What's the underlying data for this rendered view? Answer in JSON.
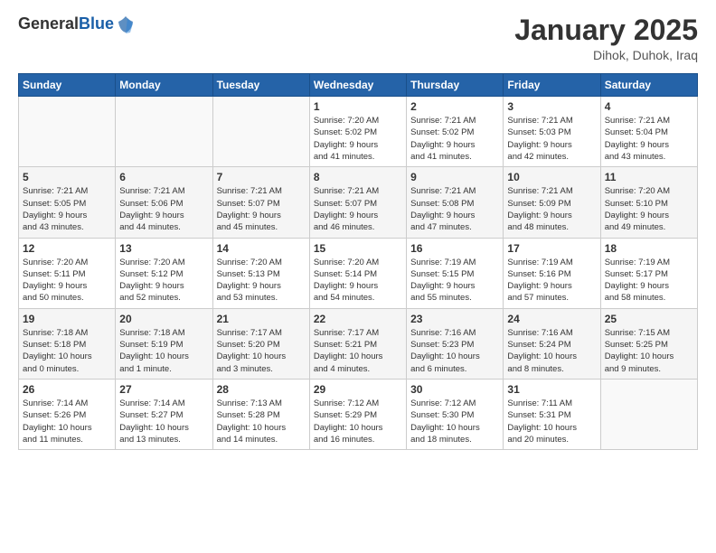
{
  "header": {
    "logo_general": "General",
    "logo_blue": "Blue",
    "month_title": "January 2025",
    "location": "Dihok, Duhok, Iraq"
  },
  "weekdays": [
    "Sunday",
    "Monday",
    "Tuesday",
    "Wednesday",
    "Thursday",
    "Friday",
    "Saturday"
  ],
  "weeks": [
    [
      {
        "day": "",
        "info": ""
      },
      {
        "day": "",
        "info": ""
      },
      {
        "day": "",
        "info": ""
      },
      {
        "day": "1",
        "info": "Sunrise: 7:20 AM\nSunset: 5:02 PM\nDaylight: 9 hours\nand 41 minutes."
      },
      {
        "day": "2",
        "info": "Sunrise: 7:21 AM\nSunset: 5:02 PM\nDaylight: 9 hours\nand 41 minutes."
      },
      {
        "day": "3",
        "info": "Sunrise: 7:21 AM\nSunset: 5:03 PM\nDaylight: 9 hours\nand 42 minutes."
      },
      {
        "day": "4",
        "info": "Sunrise: 7:21 AM\nSunset: 5:04 PM\nDaylight: 9 hours\nand 43 minutes."
      }
    ],
    [
      {
        "day": "5",
        "info": "Sunrise: 7:21 AM\nSunset: 5:05 PM\nDaylight: 9 hours\nand 43 minutes."
      },
      {
        "day": "6",
        "info": "Sunrise: 7:21 AM\nSunset: 5:06 PM\nDaylight: 9 hours\nand 44 minutes."
      },
      {
        "day": "7",
        "info": "Sunrise: 7:21 AM\nSunset: 5:07 PM\nDaylight: 9 hours\nand 45 minutes."
      },
      {
        "day": "8",
        "info": "Sunrise: 7:21 AM\nSunset: 5:07 PM\nDaylight: 9 hours\nand 46 minutes."
      },
      {
        "day": "9",
        "info": "Sunrise: 7:21 AM\nSunset: 5:08 PM\nDaylight: 9 hours\nand 47 minutes."
      },
      {
        "day": "10",
        "info": "Sunrise: 7:21 AM\nSunset: 5:09 PM\nDaylight: 9 hours\nand 48 minutes."
      },
      {
        "day": "11",
        "info": "Sunrise: 7:20 AM\nSunset: 5:10 PM\nDaylight: 9 hours\nand 49 minutes."
      }
    ],
    [
      {
        "day": "12",
        "info": "Sunrise: 7:20 AM\nSunset: 5:11 PM\nDaylight: 9 hours\nand 50 minutes."
      },
      {
        "day": "13",
        "info": "Sunrise: 7:20 AM\nSunset: 5:12 PM\nDaylight: 9 hours\nand 52 minutes."
      },
      {
        "day": "14",
        "info": "Sunrise: 7:20 AM\nSunset: 5:13 PM\nDaylight: 9 hours\nand 53 minutes."
      },
      {
        "day": "15",
        "info": "Sunrise: 7:20 AM\nSunset: 5:14 PM\nDaylight: 9 hours\nand 54 minutes."
      },
      {
        "day": "16",
        "info": "Sunrise: 7:19 AM\nSunset: 5:15 PM\nDaylight: 9 hours\nand 55 minutes."
      },
      {
        "day": "17",
        "info": "Sunrise: 7:19 AM\nSunset: 5:16 PM\nDaylight: 9 hours\nand 57 minutes."
      },
      {
        "day": "18",
        "info": "Sunrise: 7:19 AM\nSunset: 5:17 PM\nDaylight: 9 hours\nand 58 minutes."
      }
    ],
    [
      {
        "day": "19",
        "info": "Sunrise: 7:18 AM\nSunset: 5:18 PM\nDaylight: 10 hours\nand 0 minutes."
      },
      {
        "day": "20",
        "info": "Sunrise: 7:18 AM\nSunset: 5:19 PM\nDaylight: 10 hours\nand 1 minute."
      },
      {
        "day": "21",
        "info": "Sunrise: 7:17 AM\nSunset: 5:20 PM\nDaylight: 10 hours\nand 3 minutes."
      },
      {
        "day": "22",
        "info": "Sunrise: 7:17 AM\nSunset: 5:21 PM\nDaylight: 10 hours\nand 4 minutes."
      },
      {
        "day": "23",
        "info": "Sunrise: 7:16 AM\nSunset: 5:23 PM\nDaylight: 10 hours\nand 6 minutes."
      },
      {
        "day": "24",
        "info": "Sunrise: 7:16 AM\nSunset: 5:24 PM\nDaylight: 10 hours\nand 8 minutes."
      },
      {
        "day": "25",
        "info": "Sunrise: 7:15 AM\nSunset: 5:25 PM\nDaylight: 10 hours\nand 9 minutes."
      }
    ],
    [
      {
        "day": "26",
        "info": "Sunrise: 7:14 AM\nSunset: 5:26 PM\nDaylight: 10 hours\nand 11 minutes."
      },
      {
        "day": "27",
        "info": "Sunrise: 7:14 AM\nSunset: 5:27 PM\nDaylight: 10 hours\nand 13 minutes."
      },
      {
        "day": "28",
        "info": "Sunrise: 7:13 AM\nSunset: 5:28 PM\nDaylight: 10 hours\nand 14 minutes."
      },
      {
        "day": "29",
        "info": "Sunrise: 7:12 AM\nSunset: 5:29 PM\nDaylight: 10 hours\nand 16 minutes."
      },
      {
        "day": "30",
        "info": "Sunrise: 7:12 AM\nSunset: 5:30 PM\nDaylight: 10 hours\nand 18 minutes."
      },
      {
        "day": "31",
        "info": "Sunrise: 7:11 AM\nSunset: 5:31 PM\nDaylight: 10 hours\nand 20 minutes."
      },
      {
        "day": "",
        "info": ""
      }
    ]
  ]
}
